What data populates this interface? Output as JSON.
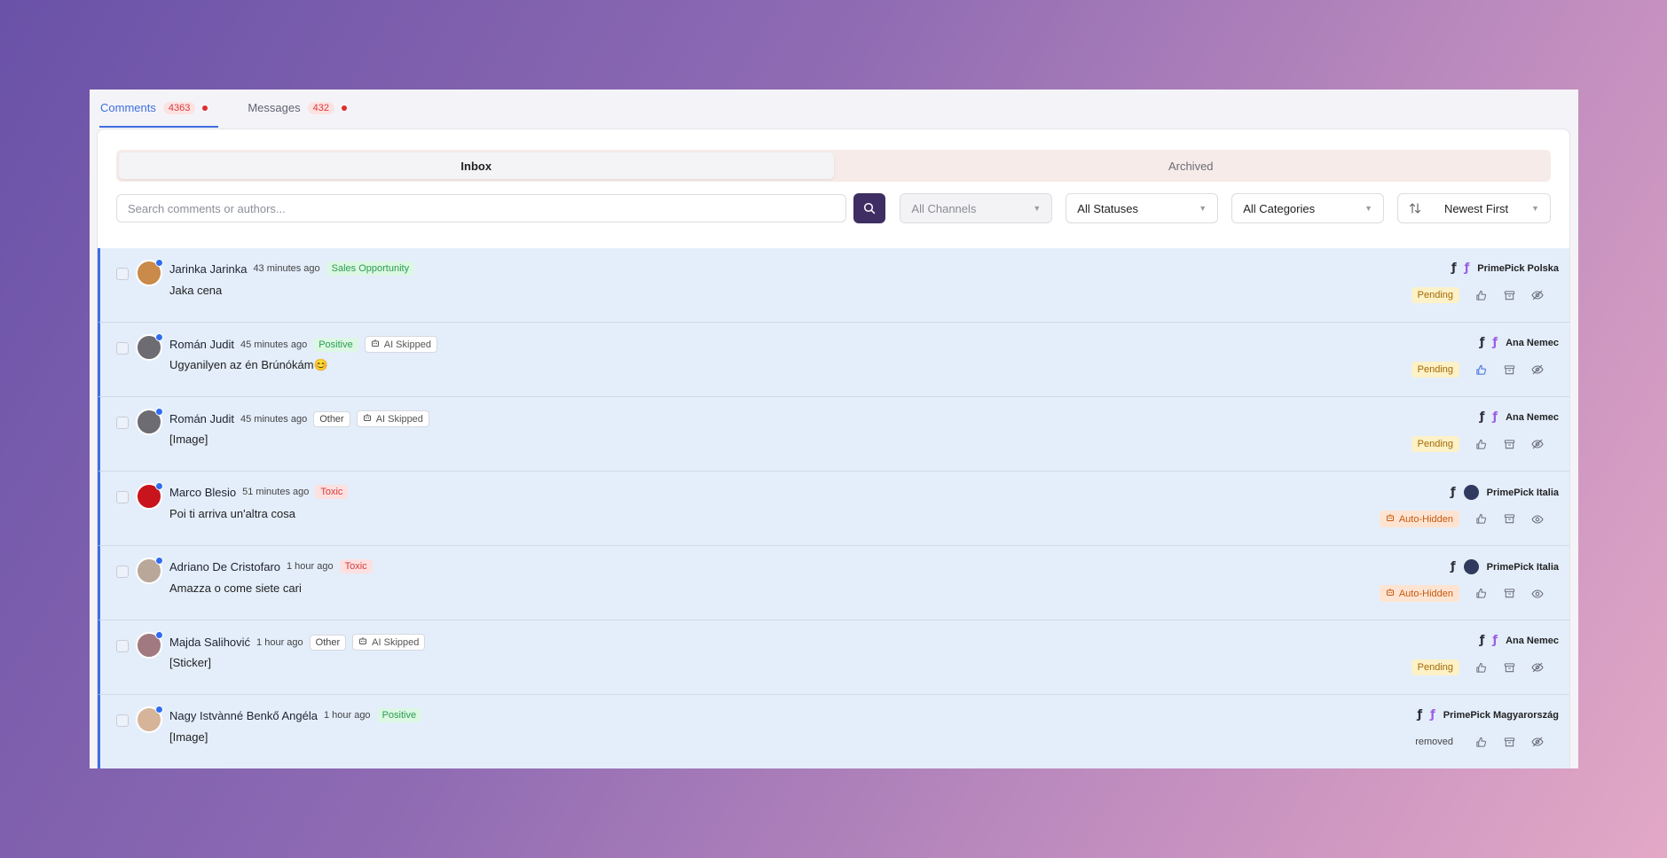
{
  "tabs": [
    {
      "label": "Comments",
      "count": "4363"
    },
    {
      "label": "Messages",
      "count": "432"
    }
  ],
  "segments": {
    "inbox": "Inbox",
    "archived": "Archived"
  },
  "filters": {
    "search_placeholder": "Search comments or authors...",
    "channels": "All Channels",
    "statuses": "All Statuses",
    "categories": "All Categories",
    "sort": "Newest First"
  },
  "colors": {
    "accent": "#3f6ee0",
    "row_bg": "#e4eefb",
    "search_button": "#3e2e63"
  },
  "comments": [
    {
      "author": "Jarinka Jarinka",
      "time": "43 minutes ago",
      "tags": [
        {
          "text": "Sales Opportunity",
          "kind": "green"
        }
      ],
      "text": "Jaka cena",
      "page": "PrimePick Polska",
      "channel": "instagram",
      "status": "Pending",
      "avatar_color": "#c98a4a"
    },
    {
      "author": "Román Judit",
      "time": "45 minutes ago",
      "tags": [
        {
          "text": "Positive",
          "kind": "green"
        },
        {
          "text": "AI Skipped",
          "kind": "ai"
        }
      ],
      "text": "Ugyanilyen az én Brúnókám😊",
      "page": "Ana Nemec",
      "channel": "instagram",
      "status": "Pending",
      "avatar_color": "#6c6c72"
    },
    {
      "author": "Román Judit",
      "time": "45 minutes ago",
      "tags": [
        {
          "text": "Other",
          "kind": "gray"
        },
        {
          "text": "AI Skipped",
          "kind": "ai"
        }
      ],
      "text": "[Image]",
      "page": "Ana Nemec",
      "channel": "instagram",
      "status": "Pending",
      "avatar_color": "#6c6c72"
    },
    {
      "author": "Marco Blesio",
      "time": "51 minutes ago",
      "tags": [
        {
          "text": "Toxic",
          "kind": "red"
        }
      ],
      "text": "Poi ti arriva un'altra cosa",
      "page": "PrimePick Italia",
      "channel": "page",
      "status": "Auto-Hidden",
      "avatar_color": "#c8141c"
    },
    {
      "author": "Adriano De Cristofaro",
      "time": "1 hour ago",
      "tags": [
        {
          "text": "Toxic",
          "kind": "red"
        }
      ],
      "text": "Amazza o come siete cari",
      "page": "PrimePick Italia",
      "channel": "page",
      "status": "Auto-Hidden",
      "avatar_color": "#b9a89a"
    },
    {
      "author": "Majda Salihović",
      "time": "1 hour ago",
      "tags": [
        {
          "text": "Other",
          "kind": "gray"
        },
        {
          "text": "AI Skipped",
          "kind": "ai"
        }
      ],
      "text": "[Sticker]",
      "page": "Ana Nemec",
      "channel": "instagram",
      "status": "Pending",
      "avatar_color": "#a07a80"
    },
    {
      "author": "Nagy Istvànné Benkő Angéla",
      "time": "1 hour ago",
      "tags": [
        {
          "text": "Positive",
          "kind": "green"
        }
      ],
      "text": "[Image]",
      "page": "PrimePick Magyarország",
      "channel": "instagram",
      "status": "removed",
      "avatar_color": "#d6b49a"
    }
  ]
}
